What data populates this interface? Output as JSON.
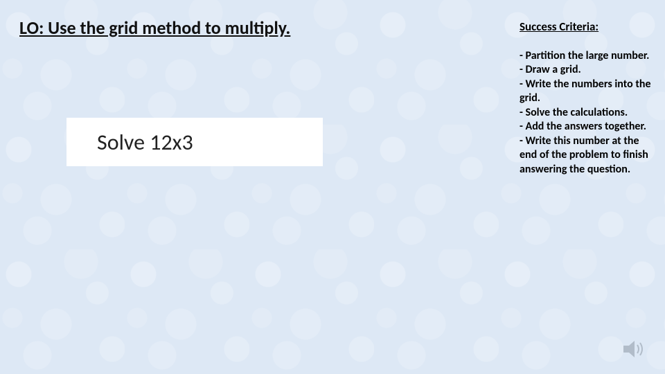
{
  "lo_title": "LO: Use the grid method to multiply.",
  "problem": "Solve 12x3",
  "criteria_heading": "Success Criteria:",
  "criteria": [
    "- Partition the large number.",
    "- Draw a grid.",
    "- Write the numbers into the grid.",
    "- Solve the calculations.",
    "- Add the answers together.",
    "- Write this number at the end of the problem to finish answering the question."
  ]
}
